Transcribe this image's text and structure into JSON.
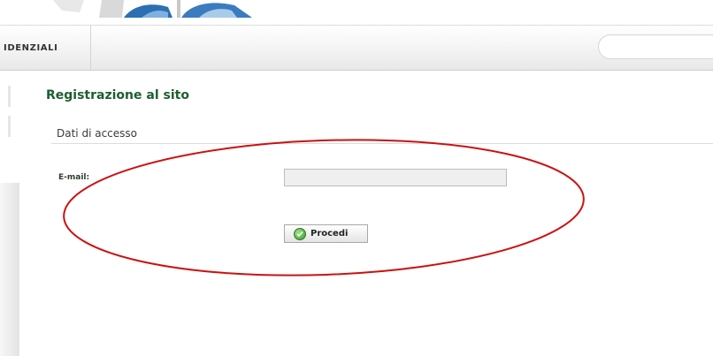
{
  "navbar": {
    "item_label": "IDENZIALI"
  },
  "page": {
    "title": "Registrazione al sito",
    "section_title": "Dati di accesso"
  },
  "form": {
    "email_label": "E-mail:",
    "email_value": "",
    "submit_label": "Procedi",
    "submit_icon": "check-circle-icon"
  },
  "colors": {
    "title_green": "#1d5e30",
    "annotation_red": "#cc1111"
  }
}
